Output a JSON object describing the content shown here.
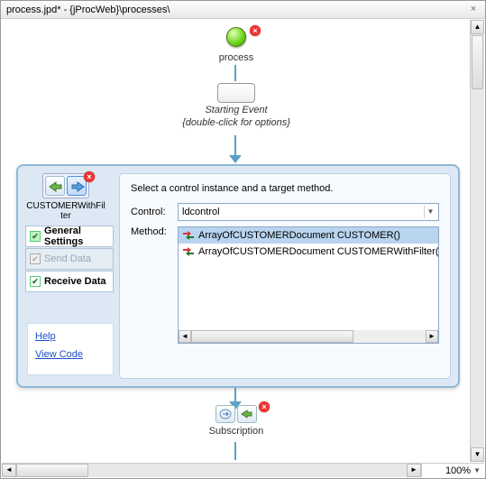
{
  "window": {
    "title": "process.jpd* - {jProcWeb}\\processes\\",
    "close_glyph": "×"
  },
  "start_node": {
    "label": "process"
  },
  "event_node": {
    "label1": "Starting Event",
    "label2": "{double-click for options}"
  },
  "panel": {
    "toolbar_label": "CUSTOMERWithFilter",
    "prompt": "Select a control instance and a target method.",
    "control_label": "Control:",
    "control_value": "ldcontrol",
    "method_label": "Method:",
    "methods": [
      "ArrayOfCUSTOMERDocument CUSTOMER()",
      "ArrayOfCUSTOMERDocument CUSTOMERWithFilter(Filter"
    ],
    "nav": {
      "general": "General Settings",
      "send": "Send Data",
      "receive": "Receive Data"
    },
    "links": {
      "help": "Help",
      "view_code": "View Code"
    },
    "close_glyph": "×"
  },
  "subscription": {
    "label": "Subscription"
  },
  "statusbar": {
    "zoom": "100%"
  }
}
